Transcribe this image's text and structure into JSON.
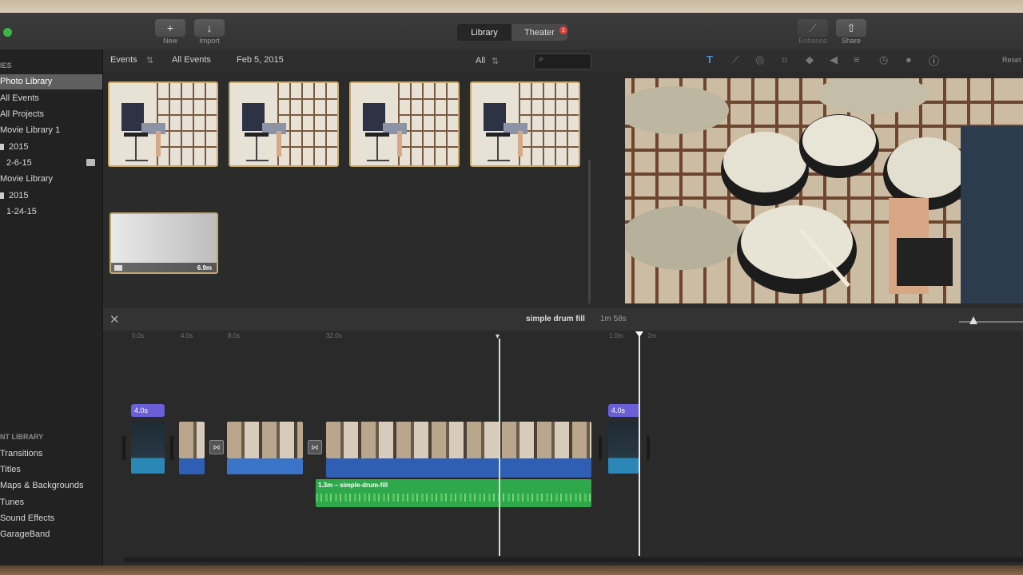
{
  "toolbar": {
    "new_label": "New",
    "import_label": "Import",
    "library_tab": "Library",
    "theater_tab": "Theater",
    "theater_badge": "1",
    "enhance_label": "Enhance",
    "share_label": "Share"
  },
  "sidebar": {
    "libraries_heading": "IES",
    "items": [
      "Photo Library",
      "All Events",
      "All Projects",
      "Movie Library 1",
      "2015",
      "2-6-15",
      "Movie Library",
      "2015",
      "1-24-15"
    ],
    "content_heading": "NT LIBRARY",
    "content_items": [
      "Transitions",
      "Titles",
      "Maps & Backgrounds",
      "Tunes",
      "Sound Effects",
      "GarageBand"
    ]
  },
  "browser": {
    "events_label": "Events",
    "all_events_crumb": "All Events",
    "date_crumb": "Feb 5, 2015",
    "filter_label": "All",
    "last_thumb_duration": "6.9m"
  },
  "viewer": {
    "reset_label": "Reset"
  },
  "timeline": {
    "project_title": "simple drum fill",
    "project_duration": "1m 58s",
    "ticks": [
      "0.0s",
      "4.0s",
      "8.0s",
      "32.0s",
      "1.0m",
      "2m"
    ],
    "title_clip_1": "4.0s",
    "title_clip_2": "4.0s",
    "music_clip_label": "1.3m – simple-drum-fill"
  },
  "colors": {
    "accent_selection": "#c8a86a",
    "audio_blue": "#2e5fb5",
    "music_green": "#2ea84a",
    "title_purple": "#6a5fd6"
  }
}
